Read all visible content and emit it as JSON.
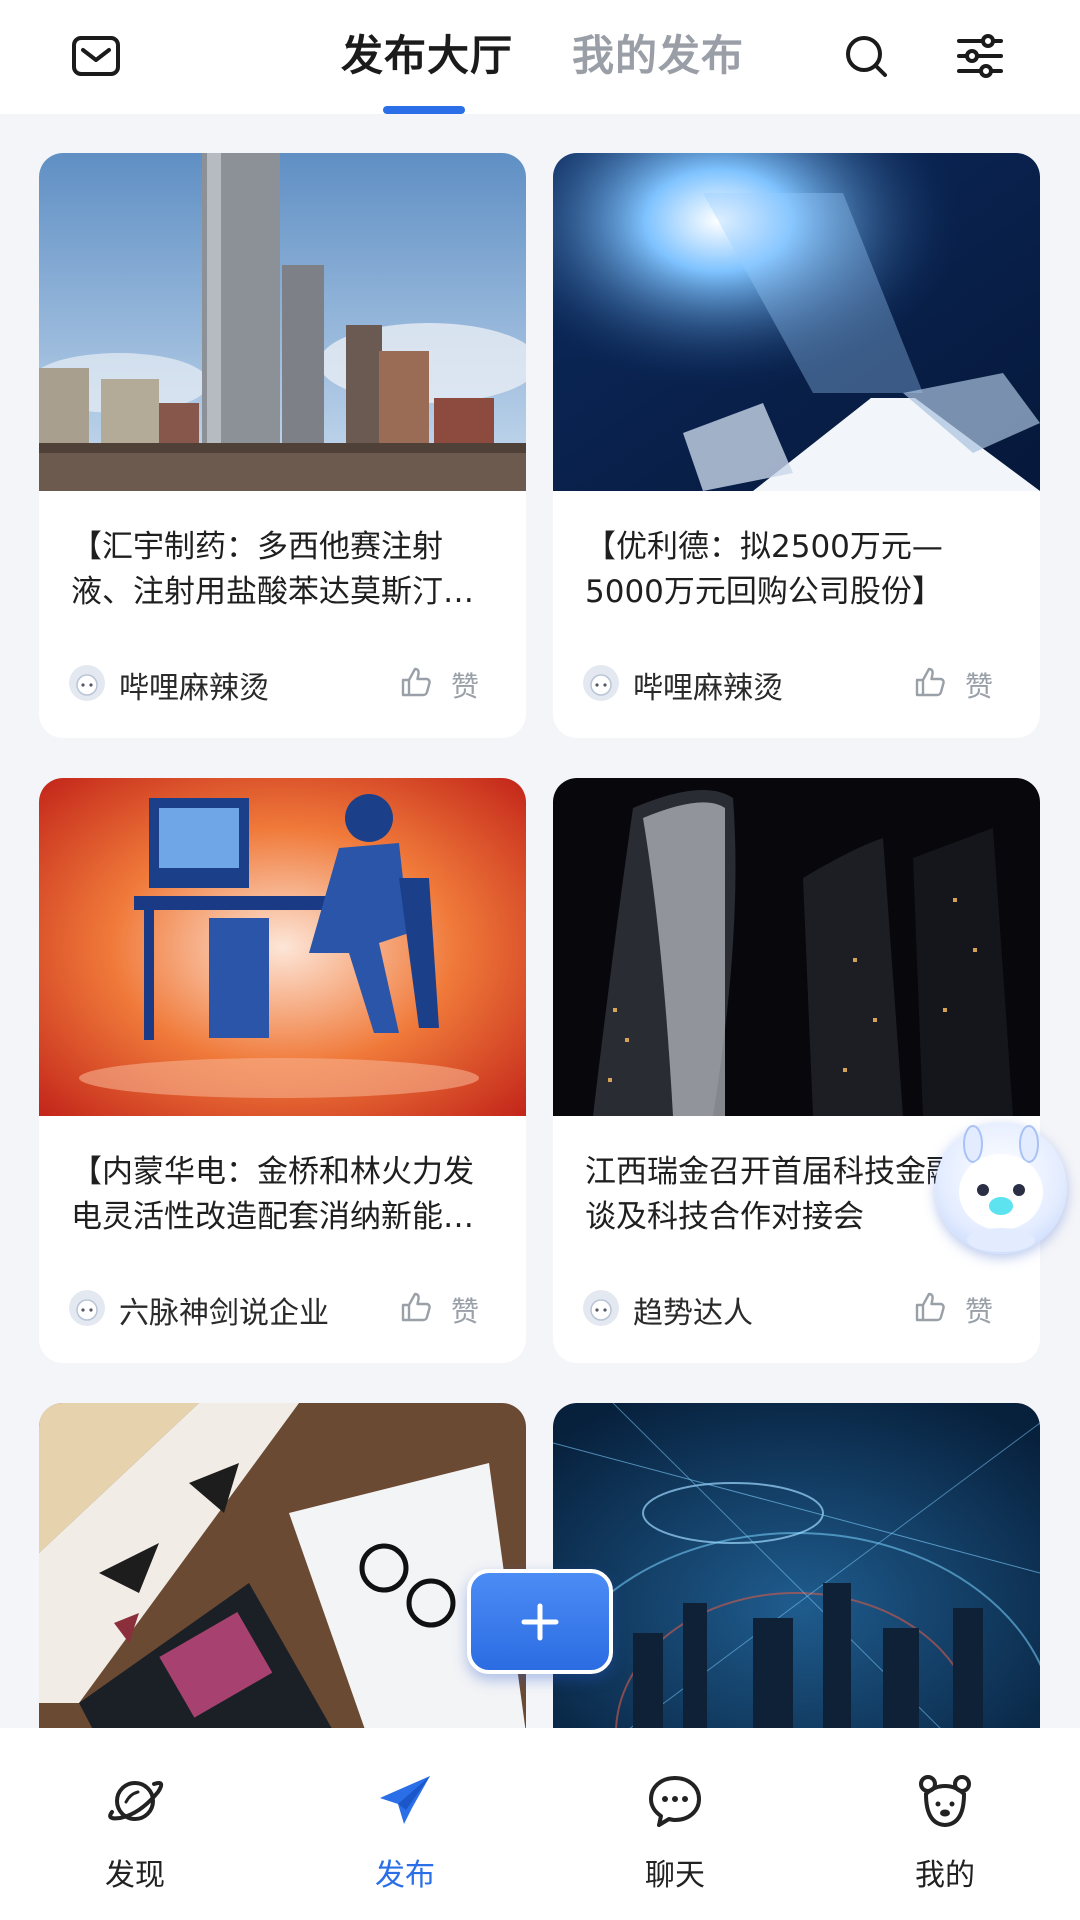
{
  "header": {
    "tabs": [
      {
        "label": "发布大厅",
        "active": true
      },
      {
        "label": "我的发布",
        "active": false
      }
    ],
    "icons": [
      "mail-icon",
      "search-icon",
      "filter-icon"
    ]
  },
  "cards": [
    {
      "title": "【汇宇制药：多西他赛注射液、注射用盐酸苯达莫斯汀获批上市】",
      "author": "哔哩麻辣烫",
      "like_label": "赞",
      "image": "city-skyscrapers"
    },
    {
      "title": "【优利德：拟2500万元—5000万元回购公司股份】",
      "author": "哔哩麻辣烫",
      "like_label": "赞",
      "image": "digital-light-keyboard"
    },
    {
      "title": "【内蒙华电：金桥和林火力发电灵活性改造配套消纳新能源项目】",
      "author": "六脉神剑说企业",
      "like_label": "赞",
      "image": "digital-person-computer"
    },
    {
      "title": "江西瑞金召开首届科技金融恳谈及科技合作对接会",
      "author": "趋势达人",
      "like_label": "赞",
      "image": "night-towers"
    },
    {
      "title": "",
      "author": "",
      "like_label": "",
      "image": "desk-laptop-glasses"
    },
    {
      "title": "",
      "author": "",
      "like_label": "",
      "image": "network-globe-city"
    }
  ],
  "fab": {
    "icon": "plus-icon"
  },
  "mascot": {
    "icon": "robot-mascot-icon"
  },
  "bottom_nav": [
    {
      "label": "发现",
      "icon": "planet-icon",
      "active": false
    },
    {
      "label": "发布",
      "icon": "paper-plane-icon",
      "active": true
    },
    {
      "label": "聊天",
      "icon": "chat-bubble-icon",
      "active": false
    },
    {
      "label": "我的",
      "icon": "bear-face-icon",
      "active": false
    }
  ],
  "colors": {
    "accent": "#2a6fe8",
    "background": "#f4f5f8",
    "muted": "#9aa0a8"
  }
}
